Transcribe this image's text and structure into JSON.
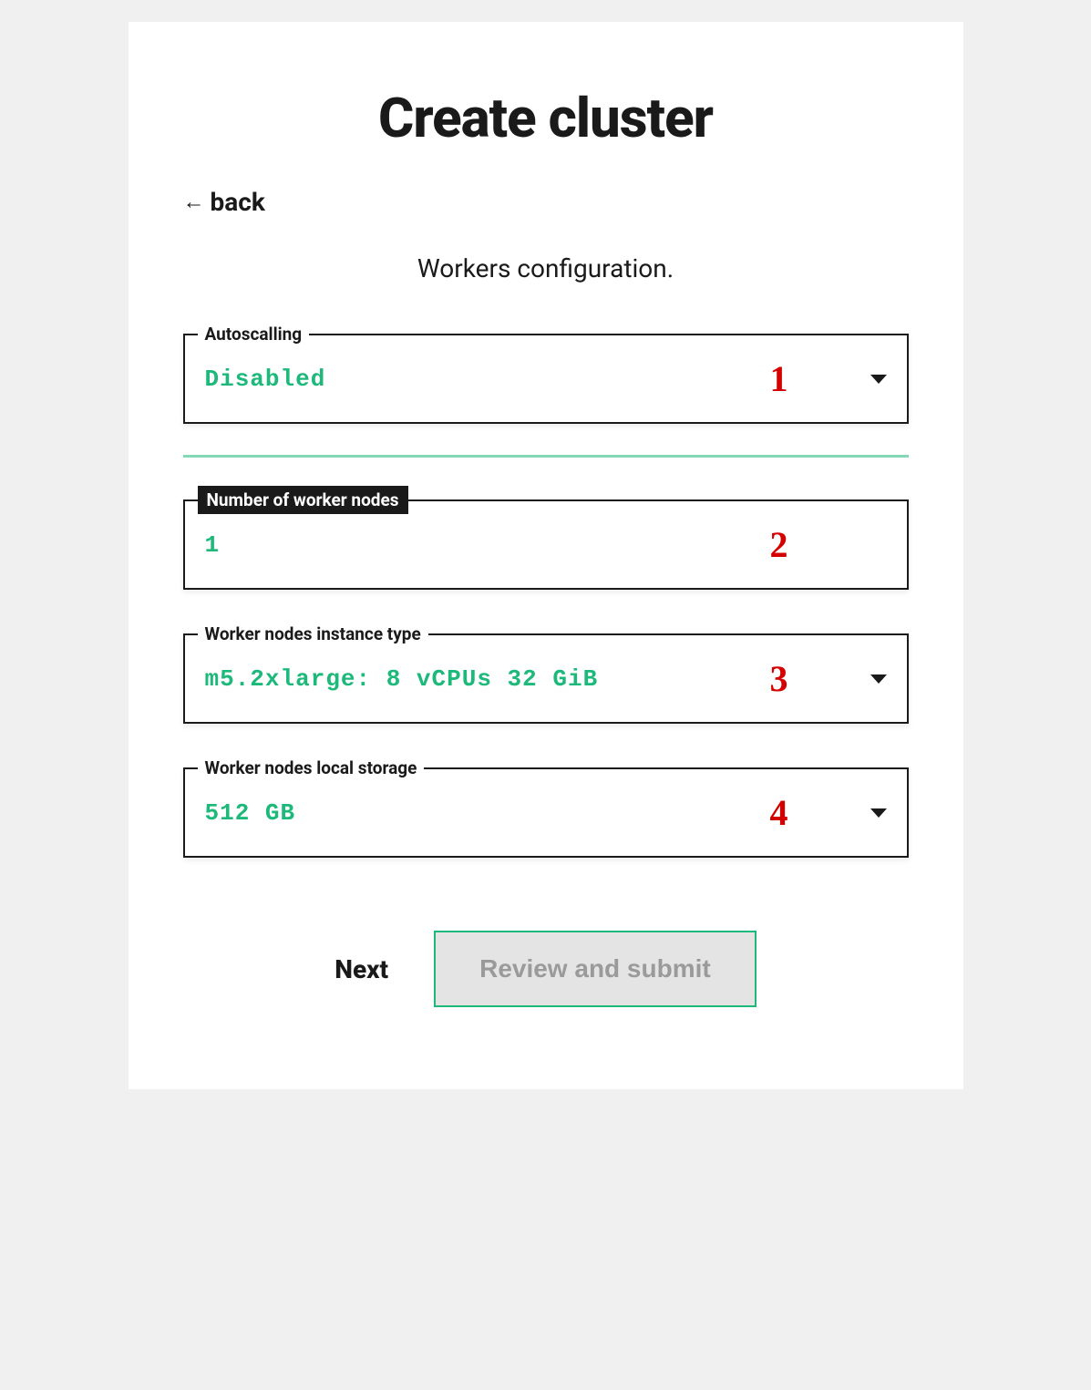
{
  "title": "Create cluster",
  "back_label": "back",
  "subtitle": "Workers configuration.",
  "fields": {
    "autoscaling": {
      "label": "Autoscalling",
      "value": "Disabled",
      "anno": "1"
    },
    "workers": {
      "label": "Number of worker nodes",
      "value": "1",
      "anno": "2"
    },
    "instance": {
      "label": "Worker nodes instance type",
      "value": "m5.2xlarge: 8 vCPUs 32 GiB",
      "anno": "3"
    },
    "storage": {
      "label": "Worker nodes local storage",
      "value": "512 GB",
      "anno": "4"
    }
  },
  "footer": {
    "next": "Next",
    "review": "Review and submit"
  }
}
